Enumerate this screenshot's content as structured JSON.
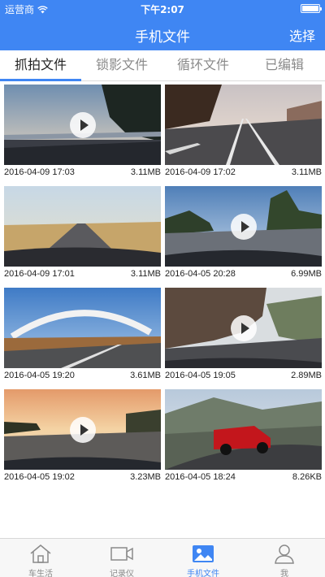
{
  "status_bar": {
    "carrier": "运营商",
    "time": "下午2:07"
  },
  "nav": {
    "title": "手机文件",
    "action": "选择"
  },
  "tabs": [
    {
      "label": "抓拍文件",
      "active": true
    },
    {
      "label": "锁影文件",
      "active": false
    },
    {
      "label": "循环文件",
      "active": false
    },
    {
      "label": "已编辑",
      "active": false
    }
  ],
  "files": [
    {
      "date": "2016-04-09 17:03",
      "size": "3.11MB",
      "has_play": true
    },
    {
      "date": "2016-04-09 17:02",
      "size": "3.11MB",
      "has_play": false
    },
    {
      "date": "2016-04-09 17:01",
      "size": "3.11MB",
      "has_play": false
    },
    {
      "date": "2016-04-05 20:28",
      "size": "6.99MB",
      "has_play": true
    },
    {
      "date": "2016-04-05 19:20",
      "size": "3.61MB",
      "has_play": false
    },
    {
      "date": "2016-04-05 19:05",
      "size": "2.89MB",
      "has_play": true
    },
    {
      "date": "2016-04-05 19:02",
      "size": "3.23MB",
      "has_play": true
    },
    {
      "date": "2016-04-05 18:24",
      "size": "8.26KB",
      "has_play": false
    }
  ],
  "tabbar": [
    {
      "label": "车生活",
      "icon": "home-icon",
      "active": false
    },
    {
      "label": "记录仪",
      "icon": "video-camera-icon",
      "active": false
    },
    {
      "label": "手机文件",
      "icon": "image-icon",
      "active": true
    },
    {
      "label": "我",
      "icon": "person-icon",
      "active": false
    }
  ],
  "colors": {
    "accent": "#3f86f3",
    "header": "#3f86f3"
  }
}
